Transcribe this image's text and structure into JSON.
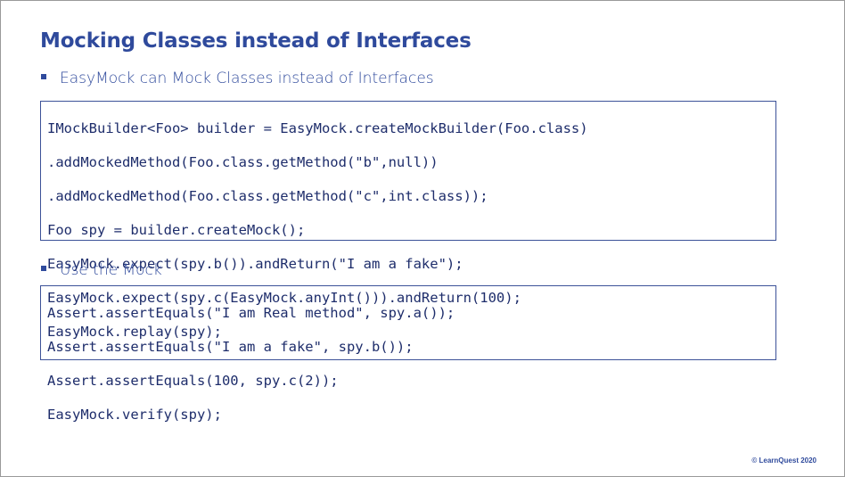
{
  "slide": {
    "title": "Mocking Classes instead of Interfaces",
    "bullets": [
      {
        "text": "EasyMock can Mock Classes instead of Interfaces"
      },
      {
        "text": "Use the Mock"
      }
    ],
    "code_blocks": [
      {
        "lines": [
          "IMockBuilder<Foo> builder = EasyMock.createMockBuilder(Foo.class)",
          ".addMockedMethod(Foo.class.getMethod(\"b\",null))",
          ".addMockedMethod(Foo.class.getMethod(\"c\",int.class));",
          "Foo spy = builder.createMock();",
          "EasyMock.expect(spy.b()).andReturn(\"I am a fake\");",
          "EasyMock.expect(spy.c(EasyMock.anyInt())).andReturn(100);",
          "EasyMock.replay(spy);"
        ]
      },
      {
        "lines": [
          "Assert.assertEquals(\"I am Real method\", spy.a());",
          "Assert.assertEquals(\"I am a fake\", spy.b());",
          "Assert.assertEquals(100, spy.c(2));",
          "EasyMock.verify(spy);"
        ]
      }
    ],
    "footer": "© LearnQuest 2020"
  },
  "colors": {
    "accent": "#2f4a9c",
    "code_border": "#3c5298"
  }
}
